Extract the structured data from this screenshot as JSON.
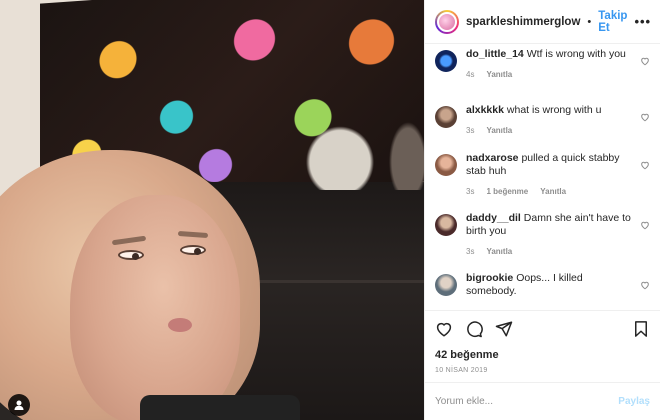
{
  "header": {
    "username": "sparkleshimmerglow",
    "separator": "•",
    "follow_label": "Takip Et",
    "more_label": "•••"
  },
  "comments": [
    {
      "username": "do_little_14",
      "text": "Wtf is wrong with you",
      "time": "4s",
      "reply_label": "Yanıtla",
      "likes_label": "",
      "avatar_color": "#1b3a8a",
      "avatar_icon": "butterfly-icon"
    },
    {
      "username": "alxkkkk",
      "text": "what is wrong with u",
      "time": "3s",
      "reply_label": "Yanıtla",
      "likes_label": "",
      "avatar_color": "#7a5a48",
      "avatar_icon": "avatar-photo"
    },
    {
      "username": "nadxarose",
      "text": "pulled a quick stabby stab huh",
      "time": "3s",
      "reply_label": "Yanıtla",
      "likes_label": "1 beğenme",
      "avatar_color": "#a6705a",
      "avatar_icon": "avatar-photo"
    },
    {
      "username": "daddy__dil",
      "text": "Damn she ain't have to birth you",
      "time": "3s",
      "reply_label": "Yanıtla",
      "likes_label": "",
      "avatar_color": "#6a3a3a",
      "avatar_icon": "avatar-photo"
    },
    {
      "username": "bigrookie",
      "text": "Oops... I killed somebody.",
      "time": "3s",
      "reply_label": "Yanıtla",
      "likes_label": "",
      "avatar_color": "#7a8a96",
      "avatar_icon": "avatar-photo"
    }
  ],
  "actions": {
    "like_icon": "heart-icon",
    "comment_icon": "comment-icon",
    "share_icon": "share-icon",
    "save_icon": "bookmark-icon"
  },
  "likes_text": "42 beğenme",
  "date_text": "10 NİSAN 2019",
  "add_comment": {
    "placeholder": "Yorum ekle...",
    "post_label": "Paylaş"
  },
  "colors": {
    "link_blue": "#3897f0",
    "muted_gray": "#8e8e8e",
    "text_dark": "#262626",
    "post_disabled": "#b2dffc"
  }
}
